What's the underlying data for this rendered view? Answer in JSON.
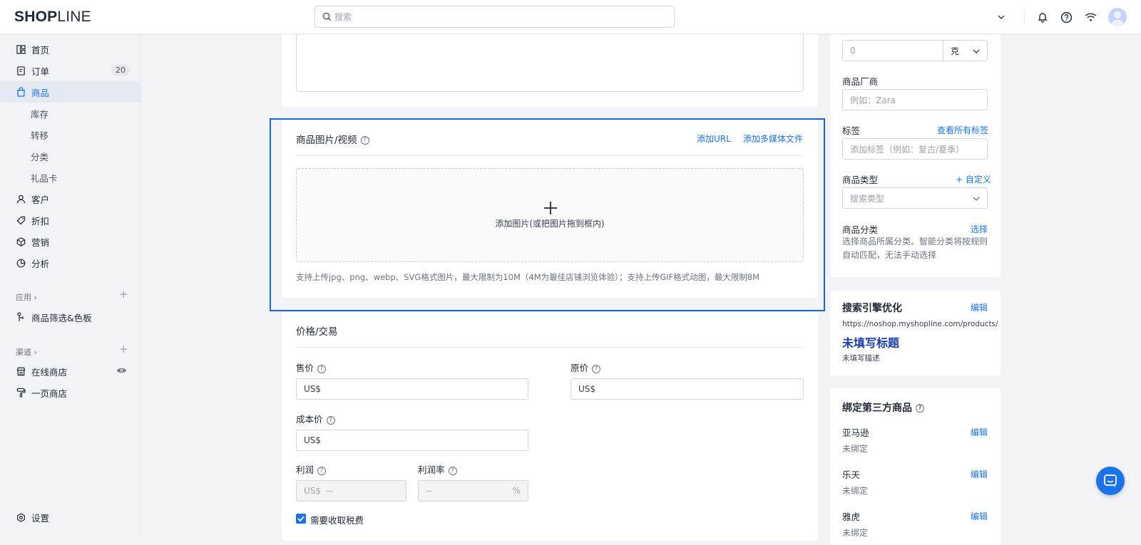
{
  "app": {
    "logo_bold": "SHOP",
    "logo_light": "LINE"
  },
  "search": {
    "placeholder": "搜索"
  },
  "sidebar": {
    "items": [
      {
        "label": "首页"
      },
      {
        "label": "订单",
        "badge": "20"
      },
      {
        "label": "商品"
      },
      {
        "label": "库存"
      },
      {
        "label": "转移"
      },
      {
        "label": "分类"
      },
      {
        "label": "礼品卡"
      },
      {
        "label": "客户"
      },
      {
        "label": "折扣"
      },
      {
        "label": "营销"
      },
      {
        "label": "分析"
      }
    ],
    "apps_section": "应用 ›",
    "apps_item": "商品筛选&色板",
    "channels_section": "渠道 ›",
    "channel_online": "在线商店",
    "channel_onepage": "一页商店",
    "settings": "设置"
  },
  "media": {
    "title": "商品图片/视频",
    "add_url": "添加URL",
    "add_media": "添加多媒体文件",
    "drop_text": "添加图片(或把图片拖到框内)",
    "hint": "支持上传jpg、png、webp、SVG格式图片，最大限制为10M（4M为最佳店铺浏览体验）；支持上传GIF格式动图，最大限制8M"
  },
  "pricing": {
    "title": "价格/交易",
    "price_label": "售价",
    "price_value": "US$",
    "compare_label": "原价",
    "compare_value": "US$",
    "cost_label": "成本价",
    "cost_value": "US$",
    "profit_label": "利润",
    "profit_value": "US$  --",
    "margin_label": "利润率",
    "margin_value": "--",
    "margin_unit": "%",
    "tax_label": "需要收取税费"
  },
  "right": {
    "weight_value": "0",
    "weight_unit": "克",
    "vendor_label": "商品厂商",
    "vendor_placeholder": "例如：Zara",
    "tags_label": "标签",
    "tags_link": "查看所有标签",
    "tags_placeholder": "添加标签（例如：复古/夏季）",
    "type_label": "商品类型",
    "type_link": "+ 自定义",
    "type_placeholder": "搜索类型",
    "category_label": "商品分类",
    "category_link": "选择",
    "category_desc_1": "选择商品所属分类。智能分类将按规则",
    "category_desc_2": "自动匹配，无法手动选择"
  },
  "seo": {
    "title": "搜索引擎优化",
    "edit": "编辑",
    "url": "https://noshop.myshopline.com/products/",
    "page_title": "未填写标题",
    "desc": "未填写描述"
  },
  "third_party": {
    "title": "绑定第三方商品",
    "items": [
      {
        "name": "亚马逊",
        "status": "未绑定",
        "edit": "编辑"
      },
      {
        "name": "乐天",
        "status": "未绑定",
        "edit": "编辑"
      },
      {
        "name": "雅虎",
        "status": "未绑定",
        "edit": "编辑"
      }
    ]
  },
  "colors": {
    "accent": "#1a73e8",
    "highlight_border": "#1565e0",
    "seo_title": "#1a3ea8"
  }
}
